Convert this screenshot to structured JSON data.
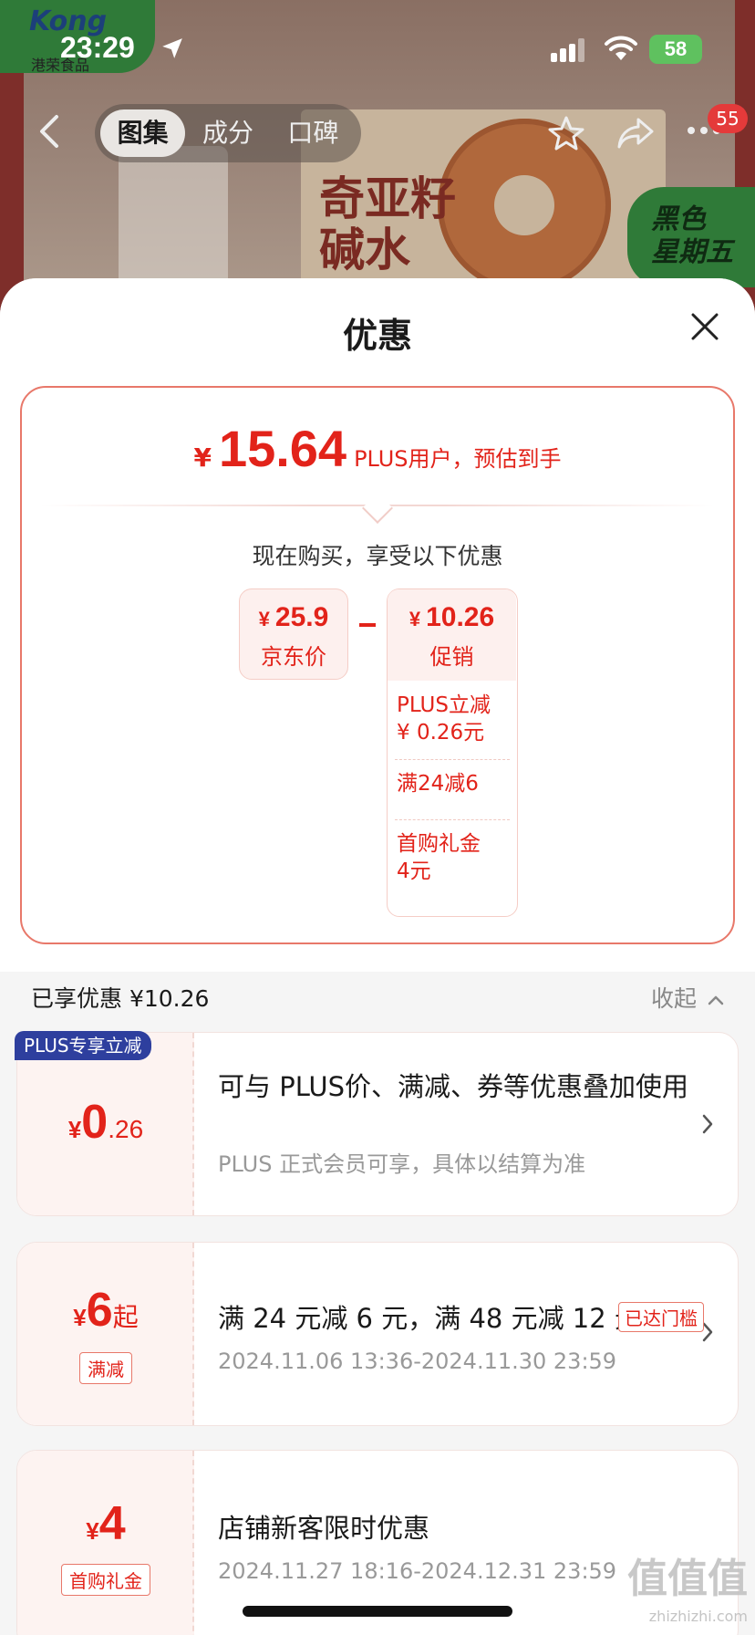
{
  "status_bar": {
    "time": "23:29",
    "battery": "58"
  },
  "background_page": {
    "logo_text": "Kong",
    "logo_sub": "港荣食品",
    "product_text": "奇亚籽\n碱水",
    "promo_badge": "黑色\n星期五"
  },
  "product_nav": {
    "tabs": [
      {
        "label": "图集",
        "active": true
      },
      {
        "label": "成分",
        "active": false
      },
      {
        "label": "口碑",
        "active": false
      }
    ],
    "badge_count": "55"
  },
  "sheet": {
    "title": "优惠",
    "estimate": {
      "currency": "¥",
      "amount": "15.64",
      "note": "PLUS用户，预估到手"
    },
    "buy_note": "现在购买，享受以下优惠",
    "jd_price": {
      "currency": "¥",
      "value": "25.9",
      "label": "京东价"
    },
    "promo": {
      "currency": "¥",
      "value": "10.26",
      "label": "促销",
      "items": [
        "PLUS立减\n¥ 0.26元",
        "满24减6",
        "首购礼金\n4元"
      ]
    },
    "enjoyed": "已享优惠 ¥10.26",
    "collapse": "收起",
    "coupons": [
      {
        "ribbon": "PLUS专享立减",
        "currency": "¥",
        "big": "0",
        "small": ".26",
        "suffix": "",
        "tag": "",
        "title": "可与 PLUS价、满减、券等优惠叠加使用",
        "sub": "PLUS 正式会员可享，具体以结算为准"
      },
      {
        "currency": "¥",
        "big": "6",
        "small": "",
        "suffix": "起",
        "tag": "满减",
        "title": "满 24 元减 6 元，满 48 元减 12 元",
        "badge": "已达门槛",
        "sub": "2024.11.06 13:36-2024.11.30 23:59"
      },
      {
        "currency": "¥",
        "big": "4",
        "small": "",
        "suffix": "",
        "tag": "首购礼金",
        "title": "店铺新客限时优惠",
        "sub": "2024.11.27 18:16-2024.12.31 23:59"
      }
    ]
  },
  "watermark": {
    "text": "值值值",
    "sub": "zhizhizhi.com"
  },
  "colors": {
    "accent": "#e2231a",
    "plus_blue": "#2e3f9e",
    "promo_green": "#2f7a38"
  }
}
